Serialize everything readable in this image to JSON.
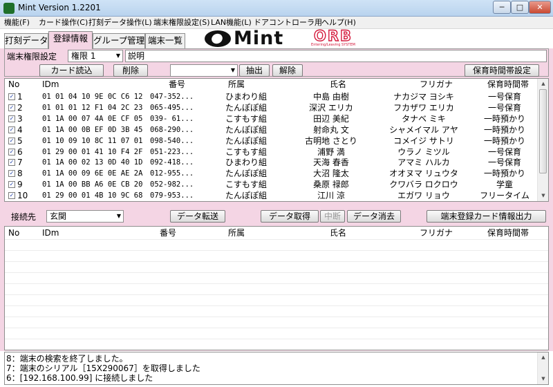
{
  "window": {
    "title": "Mint Version 1.2201",
    "min_glyph": "─",
    "max_glyph": "□",
    "close_glyph": "✕"
  },
  "menu": [
    "機能(F)",
    "カード操作(C)",
    "打刻データ操作(L)",
    "端末権限設定(S)",
    "LAN機能(L)",
    "ドアコントローラ用",
    "ヘルプ(H)"
  ],
  "tabs": [
    "打刻データ",
    "登録情報",
    "グループ管理",
    "端末一覧"
  ],
  "logo": {
    "mint": "Mint",
    "orb": "ORB",
    "orb_sub": "Entering/Leaving SYSTEM"
  },
  "toolbar1": {
    "perm_label": "端末権限設定",
    "perm_value": "権限 1",
    "desc_value": "説明",
    "read_card": "カード読込",
    "delete": "削除",
    "filter_value": "",
    "extract": "抽出",
    "cancel": "解除",
    "care_time": "保育時間帯設定"
  },
  "table1": {
    "headers": {
      "no": "No",
      "idm": "IDm",
      "num": "番号",
      "group": "所属",
      "name": "氏名",
      "kana": "フリガナ",
      "care": "保育時間帯"
    },
    "rows": [
      {
        "checked": "✓",
        "no": "1",
        "idm": "01 01 04 10 9E 0C C6 12",
        "num": "047-352...",
        "group": "ひまわり組",
        "name": "中島 由樹",
        "kana": "ナカジマ ヨシキ",
        "care": "一号保育"
      },
      {
        "checked": "✓",
        "no": "2",
        "idm": "01 01 01 12 F1 04 2C 23",
        "num": "065-495...",
        "group": "たんぽぽ組",
        "name": "深沢 エリカ",
        "kana": "フカザワ エリカ",
        "care": "一号保育"
      },
      {
        "checked": "✓",
        "no": "3",
        "idm": "01 1A 00 07 4A 0E CF 05",
        "num": "039- 61...",
        "group": "こすもす組",
        "name": "田辺 美紀",
        "kana": "タナベ ミキ",
        "care": "一時預かり"
      },
      {
        "checked": "✓",
        "no": "4",
        "idm": "01 1A 00 0B EF 0D 3B 45",
        "num": "068-290...",
        "group": "たんぽぽ組",
        "name": "射命丸 文",
        "kana": "シャメイマル アヤ",
        "care": "一時預かり"
      },
      {
        "checked": "✓",
        "no": "5",
        "idm": "01 10 09 10 8C 11 07 01",
        "num": "098-540...",
        "group": "たんぽぽ組",
        "name": "古明地 さとり",
        "kana": "コメイジ サトリ",
        "care": "一時預かり"
      },
      {
        "checked": "✓",
        "no": "6",
        "idm": "01 29 00 01 41 10 F4 2F",
        "num": "051-223...",
        "group": "こすもす組",
        "name": "浦野 満",
        "kana": "ウラノ ミツル",
        "care": "一号保育"
      },
      {
        "checked": "✓",
        "no": "7",
        "idm": "01 1A 00 02 13 0D 40 1D",
        "num": "092-418...",
        "group": "ひまわり組",
        "name": "天海 春香",
        "kana": "アマミ ハルカ",
        "care": "一号保育"
      },
      {
        "checked": "✓",
        "no": "8",
        "idm": "01 1A 00 09 6E 0E AE 2A",
        "num": "012-955...",
        "group": "たんぽぽ組",
        "name": "大沼 隆太",
        "kana": "オオヌマ リュウタ",
        "care": "一時預かり"
      },
      {
        "checked": "✓",
        "no": "9",
        "idm": "01 1A 00 BB A6 0E CB 20",
        "num": "052-982...",
        "group": "こすもす組",
        "name": "桑原 禄郎",
        "kana": "クワバラ ロクロウ",
        "care": "学童"
      },
      {
        "checked": "✓",
        "no": "10",
        "idm": "01 29 00 01 4B 10 9C 68",
        "num": "079-953...",
        "group": "たんぽぽ組",
        "name": "江川 涼",
        "kana": "エガワ リョウ",
        "care": "フリータイム"
      }
    ]
  },
  "toolbar2": {
    "dest_label": "接続先",
    "dest_value": "玄関",
    "transfer": "データ転送",
    "fetch": "データ取得",
    "interrupt": "中断",
    "erase": "データ消去",
    "export": "端末登録カード情報出力"
  },
  "table2": {
    "headers": {
      "no": "No",
      "idm": "IDm",
      "num": "番号",
      "group": "所属",
      "name": "氏名",
      "kana": "フリガナ",
      "care": "保育時間帯"
    }
  },
  "log": [
    "8：端末の検索を終了しました。",
    "7：端末のシリアル［15X290067］を取得しました",
    "6：[192.168.100.99] に接続しました"
  ],
  "colors": {
    "panel_pink": "#f4d5e4",
    "orb_red": "#d4183b",
    "check_blue": "#1c3ea8"
  }
}
